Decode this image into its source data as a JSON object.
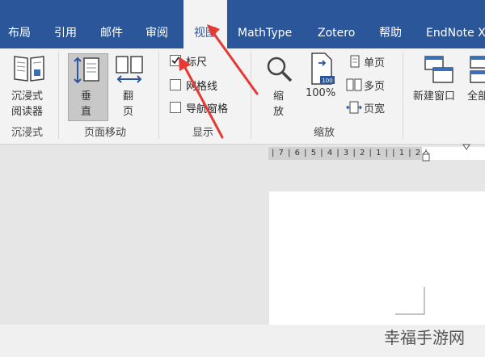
{
  "tabs": [
    "布局",
    "引用",
    "邮件",
    "审阅",
    "视图",
    "MathType",
    "Zotero",
    "帮助",
    "EndNote X"
  ],
  "ribbon": {
    "immersive": {
      "reader_label_1": "沉浸式",
      "reader_label_2": "阅读器",
      "group_label": "沉浸式"
    },
    "page_movement": {
      "vertical_1": "垂",
      "vertical_2": "直",
      "flip_1": "翻",
      "flip_2": "页",
      "group_label": "页面移动"
    },
    "show": {
      "ruler": "标尺",
      "gridlines": "网格线",
      "nav_pane": "导航窗格",
      "group_label": "显示",
      "ruler_checked": true
    },
    "zoom": {
      "zoom_1": "缩",
      "zoom_2": "放",
      "hundred": "100%",
      "single_page": "单页",
      "multi_page": "多页",
      "page_width": "页宽",
      "group_label": "缩放",
      "icon_badge": "100"
    },
    "window": {
      "new_window": "新建窗口",
      "all": "全部"
    }
  },
  "ruler": {
    "ticks": "| 7 | 6 | 5 | 4 | 3 | 2 | 1 |       | 1 | 2 |"
  },
  "watermark": "幸福手游网",
  "colors": {
    "tabbar": "#2b579a",
    "ribbon": "#f3f3f3",
    "annotation_arrow": "#e53935"
  }
}
